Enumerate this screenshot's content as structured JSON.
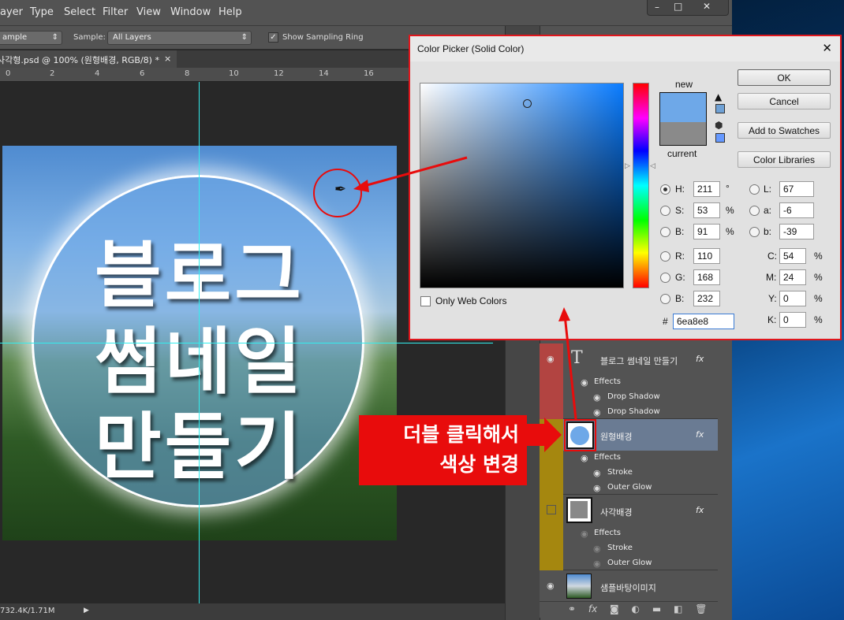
{
  "menu": [
    "ayer",
    "Type",
    "Select",
    "Filter",
    "View",
    "Window",
    "Help"
  ],
  "options": {
    "mode": "ample",
    "sample_label": "Sample:",
    "sample_value": "All Layers",
    "show_ring": "Show Sampling Ring",
    "show_ring_checked": true
  },
  "document_tab": {
    "title": "사각형.psd @ 100% (원형배경, RGB/8) *",
    "close": "×"
  },
  "ruler": [
    "0",
    "2",
    "4",
    "6",
    "8",
    "10",
    "12",
    "14",
    "16"
  ],
  "canvas": {
    "lines": [
      "블로그",
      "썸네일",
      "만들기"
    ]
  },
  "status": {
    "doc_size": "732.4K/1.71M"
  },
  "window_controls": {
    "minimize": "–",
    "maximize": "□",
    "close": "✕"
  },
  "color_picker": {
    "title": "Color Picker (Solid Color)",
    "new_label": "new",
    "current_label": "current",
    "new_color": "#6ea8e8",
    "current_color": "#8a8a8a",
    "buttons": {
      "ok": "OK",
      "cancel": "Cancel",
      "add": "Add to Swatches",
      "libraries": "Color Libraries"
    },
    "only_web": "Only Web Colors",
    "hsb": [
      {
        "label": "H:",
        "value": "211",
        "unit": "°",
        "selected": true
      },
      {
        "label": "S:",
        "value": "53",
        "unit": "%"
      },
      {
        "label": "B:",
        "value": "91",
        "unit": "%"
      }
    ],
    "rgb": [
      {
        "label": "R:",
        "value": "110"
      },
      {
        "label": "G:",
        "value": "168"
      },
      {
        "label": "B:",
        "value": "232"
      }
    ],
    "lab": [
      {
        "label": "L:",
        "value": "67"
      },
      {
        "label": "a:",
        "value": "-6"
      },
      {
        "label": "b:",
        "value": "-39"
      }
    ],
    "cmyk": [
      {
        "label": "C:",
        "value": "54",
        "unit": "%"
      },
      {
        "label": "M:",
        "value": "24",
        "unit": "%"
      },
      {
        "label": "Y:",
        "value": "0",
        "unit": "%"
      },
      {
        "label": "K:",
        "value": "0",
        "unit": "%"
      }
    ],
    "hex_label": "#",
    "hex": "6ea8e8"
  },
  "layers": [
    {
      "name": "블로그 썸네일 만들기",
      "type": "text",
      "visible": true,
      "effects": [
        "Drop Shadow",
        "Drop Shadow"
      ]
    },
    {
      "name": "원형배경",
      "type": "shape",
      "selected": true,
      "effects": [
        "Stroke",
        "Outer Glow"
      ]
    },
    {
      "name": "사각배경",
      "type": "shape",
      "visible": false,
      "effects": [
        "Stroke",
        "Outer Glow"
      ]
    },
    {
      "name": "샘플바탕이미지",
      "type": "image",
      "visible": true
    }
  ],
  "effects_label": "Effects",
  "fx": "fx",
  "annotation": {
    "line1": "더블 클릭해서",
    "line2": "색상 변경",
    "color": "#e80c0c"
  }
}
